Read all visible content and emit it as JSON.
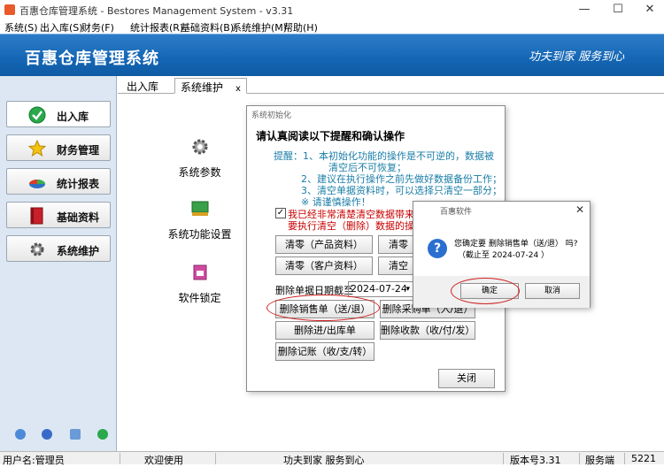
{
  "window": {
    "title": "百惠仓库管理系统 - Bestores Management System - v3.31",
    "minimize": "—",
    "maximize": "☐",
    "close": "✕"
  },
  "menu": [
    "系统(S)",
    "出入库(S)",
    "财务(F)",
    "统计报表(R)",
    "基础资料(B)",
    "系统维护(M)",
    "帮助(H)"
  ],
  "banner": {
    "app_name": "百惠仓库管理系统",
    "slogan": "功夫到家 服务到心"
  },
  "sidebar": {
    "items": [
      {
        "label": "出入库",
        "icon": "check-icon"
      },
      {
        "label": "财务管理",
        "icon": "star-icon"
      },
      {
        "label": "统计报表",
        "icon": "pie-chart-icon"
      },
      {
        "label": "基础资料",
        "icon": "book-icon"
      },
      {
        "label": "系统维护",
        "icon": "gear-icon"
      }
    ]
  },
  "tabs": [
    {
      "label": "出入库"
    },
    {
      "label": "系统维护",
      "close": "x"
    }
  ],
  "features": [
    {
      "label": "系统参数"
    },
    {
      "label": "系统功能设置"
    },
    {
      "label": "软件锁定"
    }
  ],
  "init_dialog": {
    "title": "系统初始化",
    "heading": "请认真阅读以下提醒和确认操作",
    "tips": [
      "提醒：1、本初始化功能的操作是不可逆的，数据被",
      "清空后不可恢复；",
      "2、建议在执行操作之前先做好数据备份工作；",
      "3、清空单据资料时，可以选择只清空一部分；",
      "※ 请谨慎操作！"
    ],
    "confirm_check": "✓",
    "warn_lines": [
      "我已经非常清楚清空数据带来的",
      "要执行清空（删除）数据的操作"
    ],
    "buttons": {
      "clear_products": "清零（产品资料）",
      "clear_partial_1": "清零",
      "clear_customers": "清零（客户资料）",
      "clear_partial_2": "清空",
      "delete_sales": "删除销售单（送/退）",
      "delete_purchase": "删除采购单（入/退）",
      "delete_inout": "删除进/出库单",
      "delete_receipts": "删除收款（收/付/发）",
      "delete_accounts": "删除记账（收/支/转）",
      "close": "关闭"
    },
    "date_label": "删除单据日期截至",
    "date_value": "2024-07-24",
    "date_arrow": "▾"
  },
  "confirm_dialog": {
    "title": "百惠软件",
    "close": "✕",
    "icon": "question-icon",
    "icon_glyph": "?",
    "message": "您确定要 删除销售单（送/退） 吗?",
    "sub": "（截止至 2024-07-24 ）",
    "ok": "确定",
    "cancel": "取消"
  },
  "status": {
    "user": "用户名:管理员",
    "welcome": "欢迎使用",
    "slogan": "功夫到家 服务到心",
    "version": "版本号3.31",
    "server": "服务端",
    "number": "5221"
  },
  "colors": {
    "banner": "#1466b4",
    "highlight_circle": "#d02020",
    "tip_text": "#1a7da6",
    "warn_text": "#c80000"
  }
}
